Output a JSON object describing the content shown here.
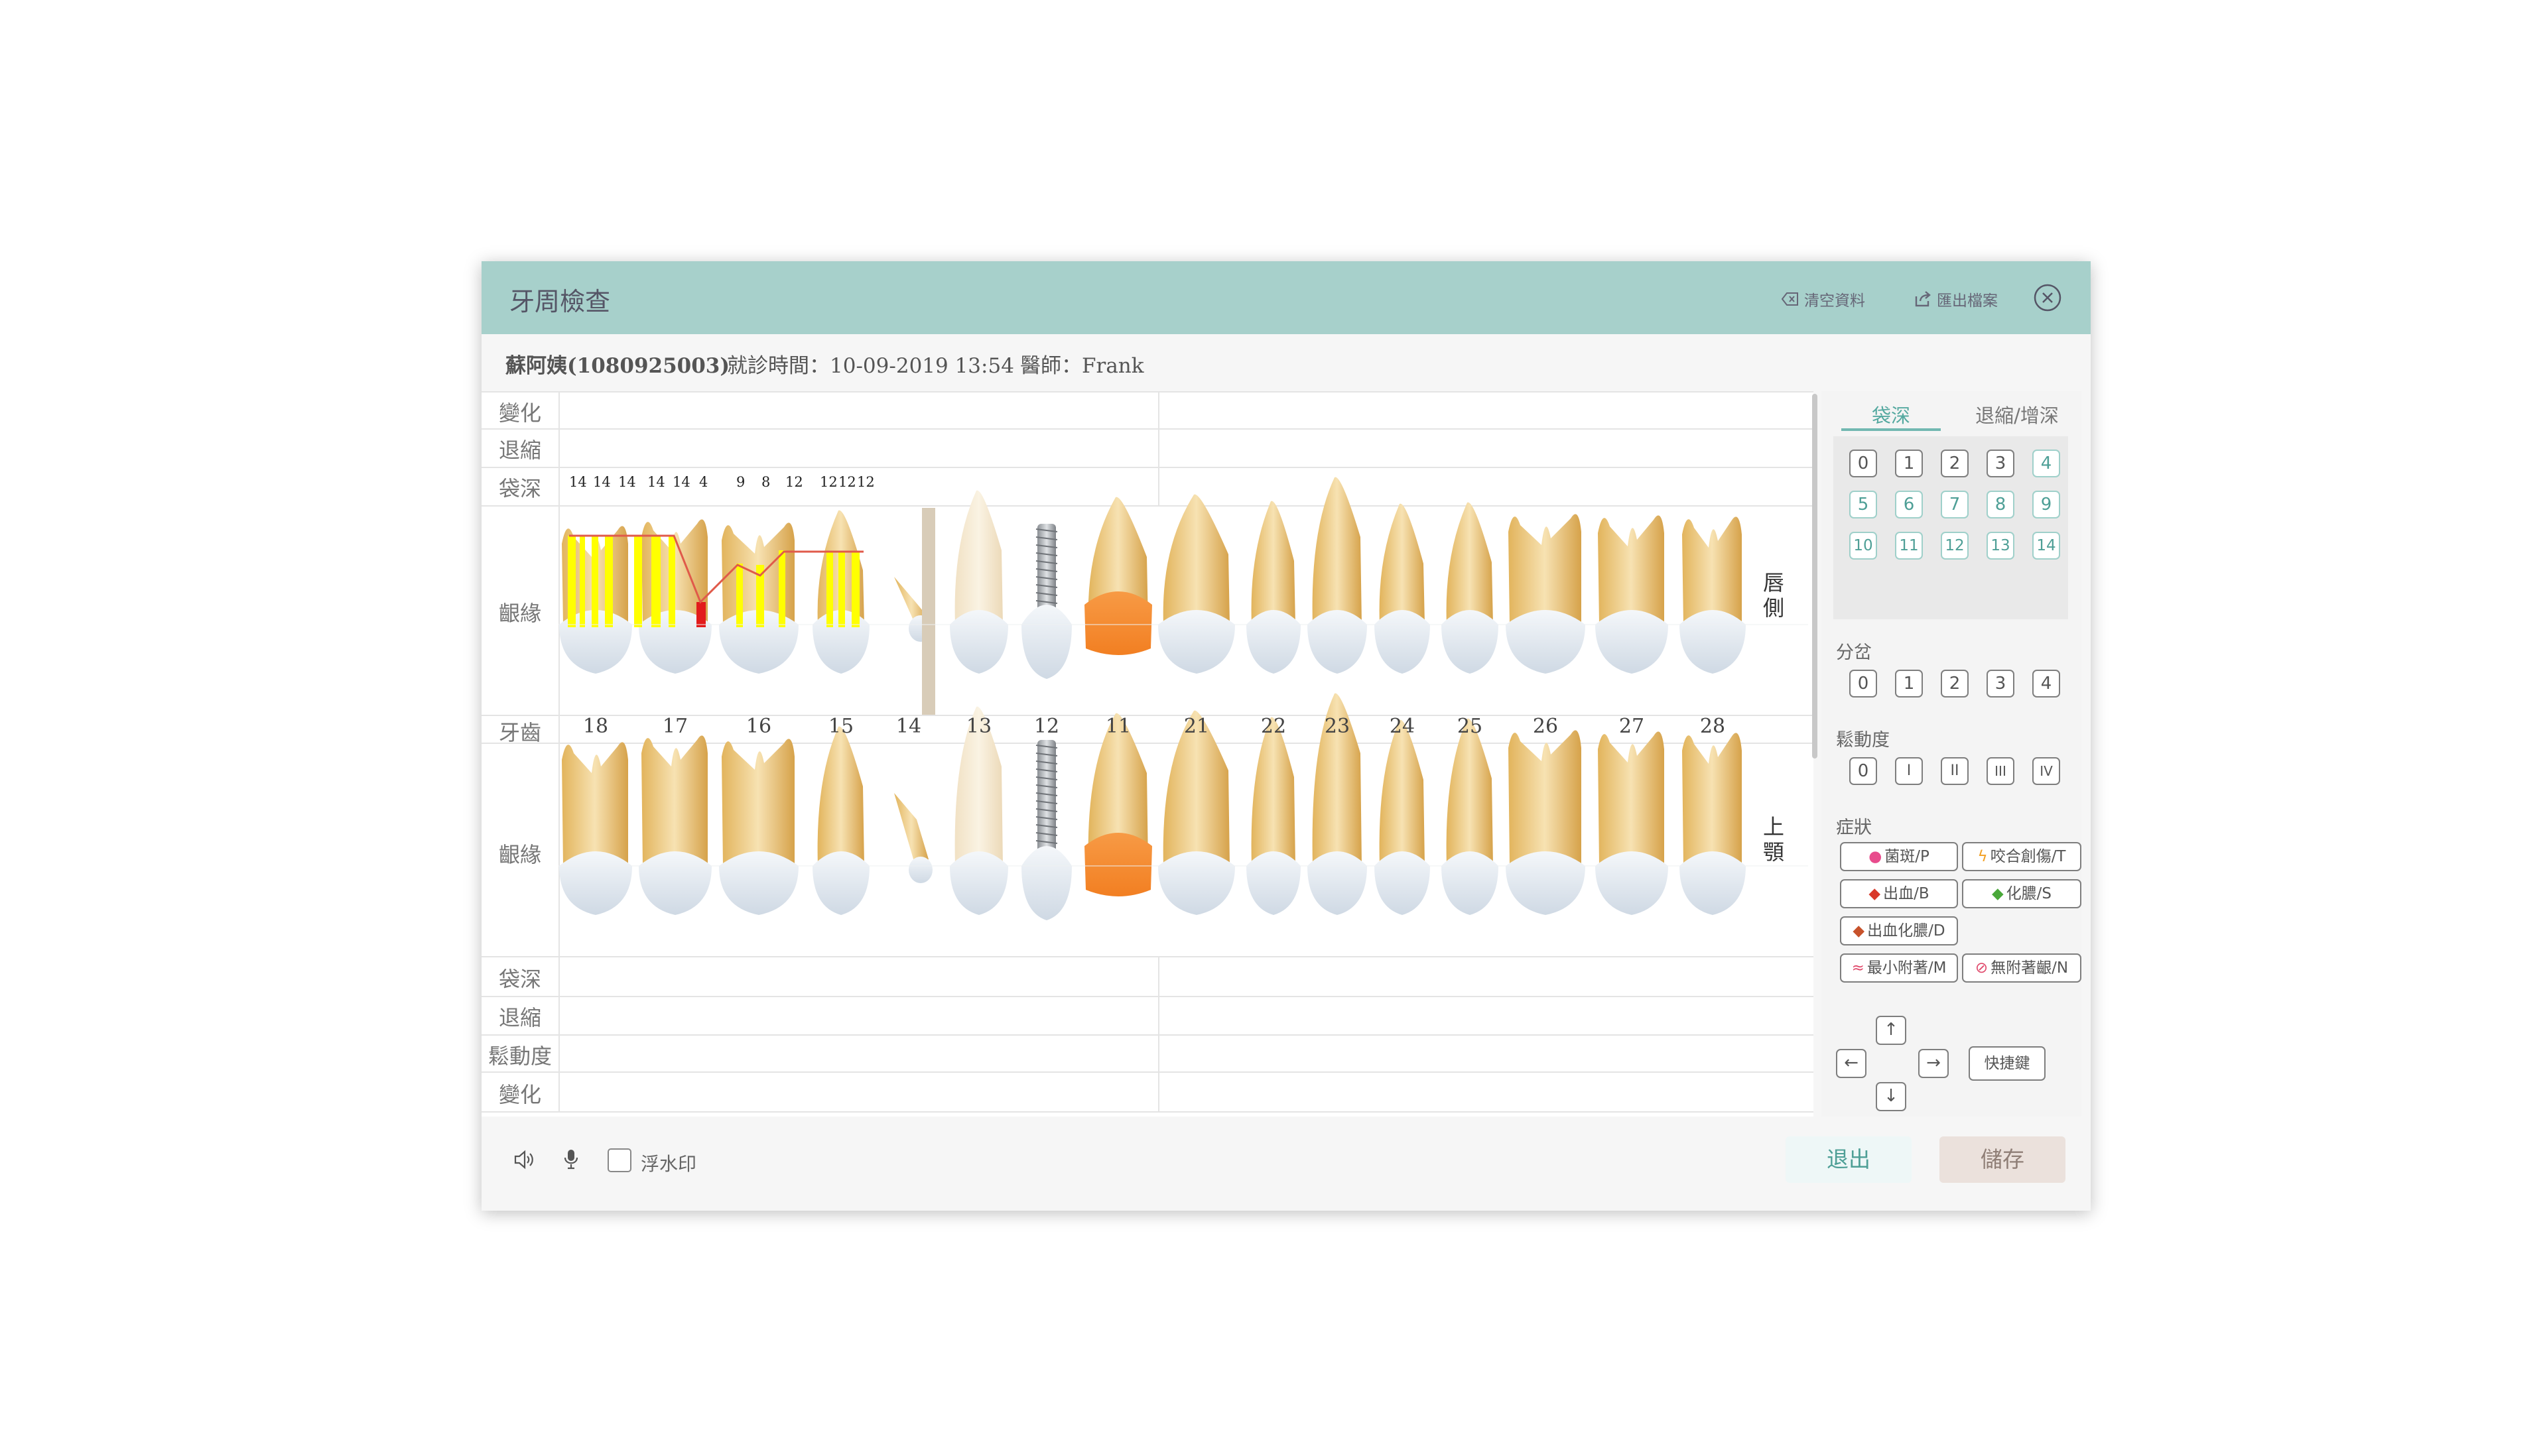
{
  "dialog": {
    "title": "牙周檢查",
    "clear_label": "清空資料",
    "export_label": "匯出檔案"
  },
  "patient": {
    "name": "蘇阿姨(1080925003)",
    "visit": "就診時間：10-09-2019 13:54",
    "doctor": "醫師：Frank"
  },
  "chart": {
    "row_labels_top": [
      "變化",
      "退縮",
      "袋深",
      "齦緣",
      "牙齒"
    ],
    "row_labels_bottom": [
      "齦緣",
      "袋深",
      "退縮",
      "鬆動度",
      "變化"
    ],
    "pocket_depths": [
      "14",
      "14",
      "14",
      "14",
      "14",
      "4",
      "9",
      "8",
      "12",
      "12",
      "12",
      "12"
    ],
    "tooth_numbers": [
      "18",
      "17",
      "16",
      "15",
      "14",
      "13",
      "12",
      "11",
      "21",
      "22",
      "23",
      "24",
      "25",
      "26",
      "27",
      "28"
    ],
    "side_upper_label": "唇側",
    "side_lower_label": "上顎"
  },
  "panel": {
    "tab_pocket": "袋深",
    "tab_recession": "退縮/增深",
    "pocket_values": [
      "0",
      "1",
      "2",
      "3",
      "4",
      "5",
      "6",
      "7",
      "8",
      "9",
      "10",
      "11",
      "12",
      "13",
      "14"
    ],
    "furcation_label": "分岔",
    "furcation_values": [
      "0",
      "1",
      "2",
      "3",
      "4"
    ],
    "mobility_label": "鬆動度",
    "mobility_values": [
      "0",
      "I",
      "II",
      "III",
      "IV"
    ],
    "symptom_label": "症狀",
    "symptoms": [
      "菌斑/P",
      "咬合創傷/T",
      "出血/B",
      "化膿/S",
      "出血化膿/D",
      "最小附著/M",
      "無附著齦/N"
    ],
    "shortcut_label": "快捷鍵",
    "arrows": [
      "↑",
      "←",
      "→",
      "↓"
    ]
  },
  "footer": {
    "watermark_label": "浮水印",
    "exit_label": "退出",
    "save_label": "儲存"
  },
  "colors": {
    "header": "#a7d0cb",
    "accent": "#4e9f96",
    "highlight_yellow": "#ffff00",
    "marker_red": "#e21b1b",
    "selected_tooth": "#f8973e"
  }
}
